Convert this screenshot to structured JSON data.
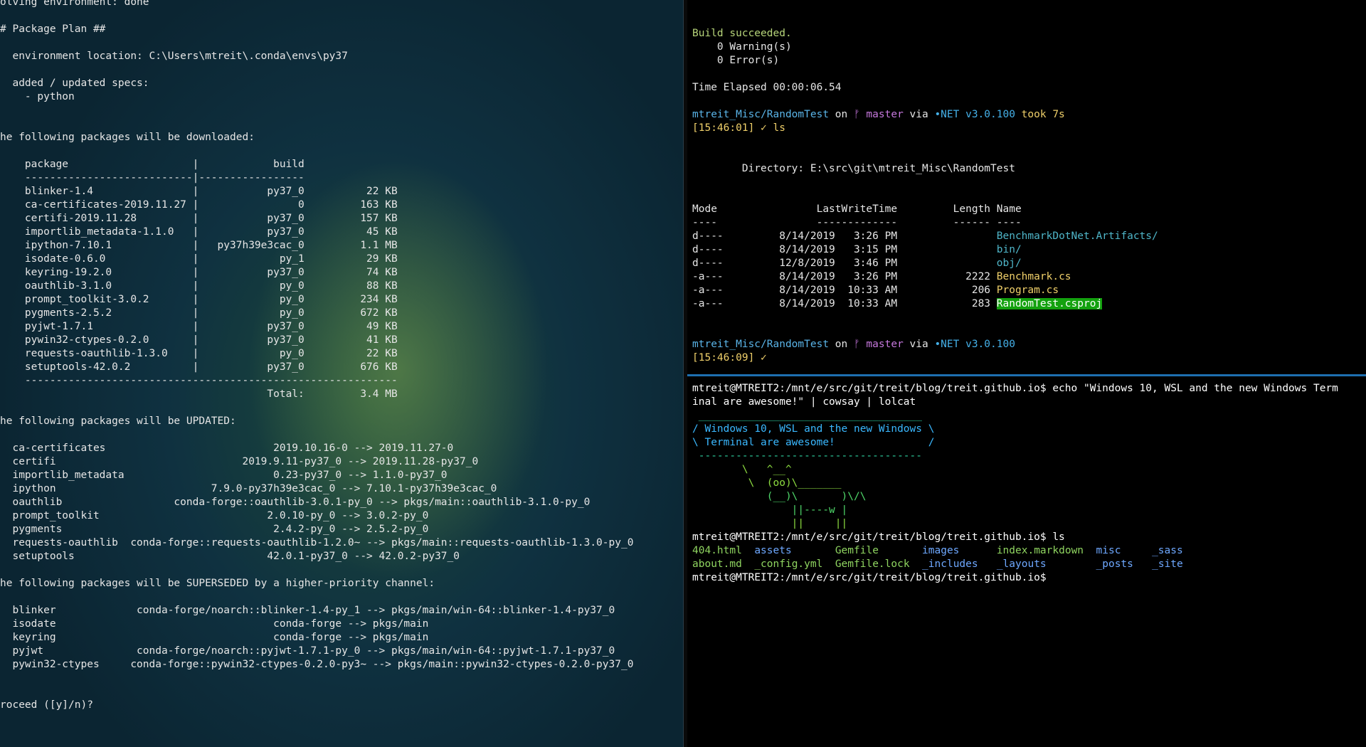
{
  "left_terminal": {
    "lines": [
      "olving environment: done",
      "",
      "# Package Plan ##",
      "",
      "  environment location: C:\\Users\\mtreit\\.conda\\envs\\py37",
      "",
      "  added / updated specs:",
      "    - python",
      "",
      "",
      "he following packages will be downloaded:",
      "",
      "    package                    |            build",
      "    ---------------------------|-----------------",
      "    blinker-1.4                |           py37_0          22 KB",
      "    ca-certificates-2019.11.27 |                0         163 KB",
      "    certifi-2019.11.28         |           py37_0         157 KB",
      "    importlib_metadata-1.1.0   |           py37_0          45 KB",
      "    ipython-7.10.1             |   py37h39e3cac_0         1.1 MB",
      "    isodate-0.6.0              |             py_1          29 KB",
      "    keyring-19.2.0             |           py37_0          74 KB",
      "    oauthlib-3.1.0             |             py_0          88 KB",
      "    prompt_toolkit-3.0.2       |             py_0         234 KB",
      "    pygments-2.5.2             |             py_0         672 KB",
      "    pyjwt-1.7.1                |           py37_0          49 KB",
      "    pywin32-ctypes-0.2.0       |           py37_0          41 KB",
      "    requests-oauthlib-1.3.0    |             py_0          22 KB",
      "    setuptools-42.0.2          |           py37_0         676 KB",
      "    ------------------------------------------------------------",
      "                                           Total:         3.4 MB",
      "",
      "he following packages will be UPDATED:",
      "",
      "  ca-certificates                           2019.10.16-0 --> 2019.11.27-0",
      "  certifi                              2019.9.11-py37_0 --> 2019.11.28-py37_0",
      "  importlib_metadata                        0.23-py37_0 --> 1.1.0-py37_0",
      "  ipython                         7.9.0-py37h39e3cac_0 --> 7.10.1-py37h39e3cac_0",
      "  oauthlib                  conda-forge::oauthlib-3.0.1-py_0 --> pkgs/main::oauthlib-3.1.0-py_0",
      "  prompt_toolkit                           2.0.10-py_0 --> 3.0.2-py_0",
      "  pygments                                  2.4.2-py_0 --> 2.5.2-py_0",
      "  requests-oauthlib  conda-forge::requests-oauthlib-1.2.0~ --> pkgs/main::requests-oauthlib-1.3.0-py_0",
      "  setuptools                               42.0.1-py37_0 --> 42.0.2-py37_0",
      "",
      "he following packages will be SUPERSEDED by a higher-priority channel:",
      "",
      "  blinker             conda-forge/noarch::blinker-1.4-py_1 --> pkgs/main/win-64::blinker-1.4-py37_0",
      "  isodate                                   conda-forge --> pkgs/main",
      "  keyring                                   conda-forge --> pkgs/main",
      "  pyjwt               conda-forge/noarch::pyjwt-1.7.1-py_0 --> pkgs/main/win-64::pyjwt-1.7.1-py37_0",
      "  pywin32-ctypes     conda-forge::pywin32-ctypes-0.2.0-py3~ --> pkgs/main::pywin32-ctypes-0.2.0-py37_0",
      "",
      "",
      "roceed ([y]/n)?"
    ]
  },
  "right_top_terminal": {
    "build_succeeded": "Build succeeded.",
    "warnings": "    0 Warning(s)",
    "errors": "    0 Error(s)",
    "time_elapsed": "Time Elapsed 00:00:06.54",
    "prompt1": {
      "path": "mtreit_Misc/RandomTest",
      "on": " on ",
      "branch_icon": "ᚠ",
      "branch": " master",
      "via": " via ",
      "net": "•NET v3.0.100",
      "took": " took 7s"
    },
    "cmd1": "[15:46:01] ✓ ls",
    "directory": "        Directory: E:\\src\\git\\mtreit_Misc\\RandomTest",
    "header": "Mode                LastWriteTime         Length Name",
    "header_rule": "----                -------------         ------ ----",
    "rows": [
      {
        "meta": "d----         8/14/2019   3:26 PM                ",
        "name": "BenchmarkDotNet.Artifacts/",
        "kind": "dir"
      },
      {
        "meta": "d----         8/14/2019   3:15 PM                ",
        "name": "bin/",
        "kind": "dir"
      },
      {
        "meta": "d----         12/8/2019   3:46 PM                ",
        "name": "obj/",
        "kind": "dir"
      },
      {
        "meta": "-a---         8/14/2019   3:26 PM           2222 ",
        "name": "Benchmark.cs",
        "kind": "file"
      },
      {
        "meta": "-a---         8/14/2019  10:33 AM            206 ",
        "name": "Program.cs",
        "kind": "file"
      },
      {
        "meta": "-a---         8/14/2019  10:33 AM            283 ",
        "name": "RandomTest.csproj",
        "kind": "proj"
      }
    ],
    "prompt2": {
      "path": "mtreit_Misc/RandomTest",
      "on": " on ",
      "branch_icon": "ᚠ",
      "branch": " master",
      "via": " via ",
      "net": "•NET v3.0.100"
    },
    "cmd2": "[15:46:09] ✓"
  },
  "right_bottom_terminal": {
    "cmd_line1": "mtreit@MTREIT2:/mnt/e/src/git/treit/blog/treit.github.io$ echo \"Windows 10, WSL and the new Windows Term",
    "cmd_line2": "inal are awesome!\" | cowsay | lolcat",
    "cowsay": [
      " ____________________________________",
      "/ Windows 10, WSL and the new Windows \\",
      "\\ Terminal are awesome!               /",
      " ------------------------------------",
      "        \\   ^__^",
      "         \\  (oo)\\_______",
      "            (__)\\       )\\/\\",
      "                ||----w |",
      "                ||     ||"
    ],
    "ls_cmd": "mtreit@MTREIT2:/mnt/e/src/git/treit/blog/treit.github.io$ ls",
    "ls_row1": [
      "404.html",
      "assets",
      "Gemfile",
      "images",
      "index.markdown",
      "misc",
      "_sass"
    ],
    "ls_row2": [
      "about.md",
      "_config.yml",
      "Gemfile.lock",
      "_includes",
      "_layouts",
      "_posts",
      "_site"
    ],
    "final_prompt": "mtreit@MTREIT2:/mnt/e/src/git/treit/blog/treit.github.io$"
  },
  "colors": {
    "pane_divider": "#1e6fb0",
    "build_ok": "#b7d57a",
    "path": "#5ab4e8",
    "branch": "#c678dd",
    "net": "#45b0e8",
    "took": "#f0d06a",
    "highlight": "#13a10e"
  }
}
